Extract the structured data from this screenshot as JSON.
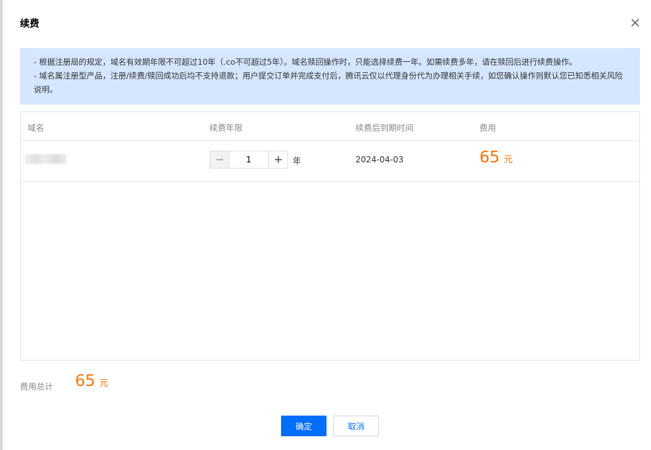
{
  "dialog": {
    "title": "续费",
    "notice": {
      "line1": "- 根据注册局的规定，域名有效期年限不可超过10年（.co不可超过5年）。域名赎回操作时，只能选择续费一年。如需续费多年，请在赎回后进行续费操作。",
      "line2": "- 域名属注册型产品，注册/续费/赎回成功后均不支持退款；用户提交订单并完成支付后，腾讯云仅以代理身份代为办理相关手续，如您确认操作则默认您已知悉相关风险说明。"
    },
    "table": {
      "headers": [
        "域名",
        "续费年限",
        "续费后到期时间",
        "费用"
      ],
      "row": {
        "years": "1",
        "year_unit": "年",
        "expire_date": "2024-04-03",
        "price": "65",
        "currency": "元"
      }
    },
    "total": {
      "label": "费用总计",
      "price": "65",
      "currency": "元"
    },
    "buttons": {
      "ok": "确定",
      "cancel": "取消"
    }
  },
  "icons": {
    "close": "close-icon",
    "minus": "minus-icon",
    "plus": "plus-icon"
  },
  "colors": {
    "accent": "#006eff",
    "price": "#ff7200",
    "notice_bg": "#d5e7ff"
  }
}
